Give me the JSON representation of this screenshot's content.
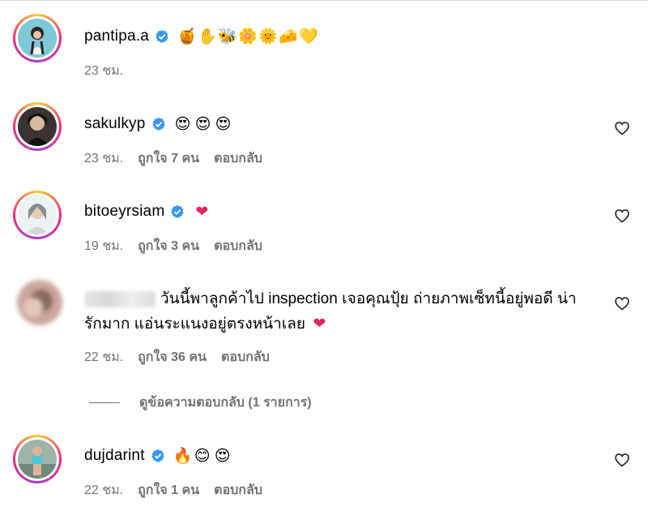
{
  "comments": [
    {
      "username": "pantipa.a",
      "verified": true,
      "emoji": [
        "🍯",
        "✋",
        "🐝",
        "🌼",
        "🌞",
        "🧀",
        "💛"
      ],
      "time": "23 ชม.",
      "likes": "",
      "reply": "",
      "heart_icon": false
    },
    {
      "username": "sakulkyp",
      "verified": true,
      "emoji": [
        "😍",
        "😍",
        "😍"
      ],
      "time": "23 ชม.",
      "likes": "ถูกใจ 7 คน",
      "reply": "ตอบกลับ",
      "heart_icon": true
    },
    {
      "username": "bitoeyrsiam",
      "verified": true,
      "emoji": [
        "❤"
      ],
      "time": "19 ชม.",
      "likes": "ถูกใจ 3 คน",
      "reply": "ตอบกลับ",
      "heart_icon": true
    },
    {
      "username": "",
      "verified": false,
      "text": "วันนี้พาลูกค้าไป inspection เจอคุณปุ้ย ถ่ายภาพเซ็ทนี้อยู่พอดี น่ารักมาก แอ่นระแนงอยู่ตรงหน้าเลย",
      "emoji": [
        "❤"
      ],
      "time": "22 ชม.",
      "likes": "ถูกใจ 36 คน",
      "reply": "ตอบกลับ",
      "heart_icon": true,
      "view_replies": "ดูข้อความตอบกลับ (1 รายการ)"
    },
    {
      "username": "dujdarint",
      "verified": true,
      "emoji": [
        "🔥",
        "😊",
        "😍"
      ],
      "time": "22 ชม.",
      "likes": "ถูกใจ 1 คน",
      "reply": "ตอบกลับ",
      "heart_icon": true
    }
  ],
  "colors": {
    "verified": "#3797f0",
    "secondary_text": "#737373",
    "story_ring": "#ee2a7b"
  }
}
